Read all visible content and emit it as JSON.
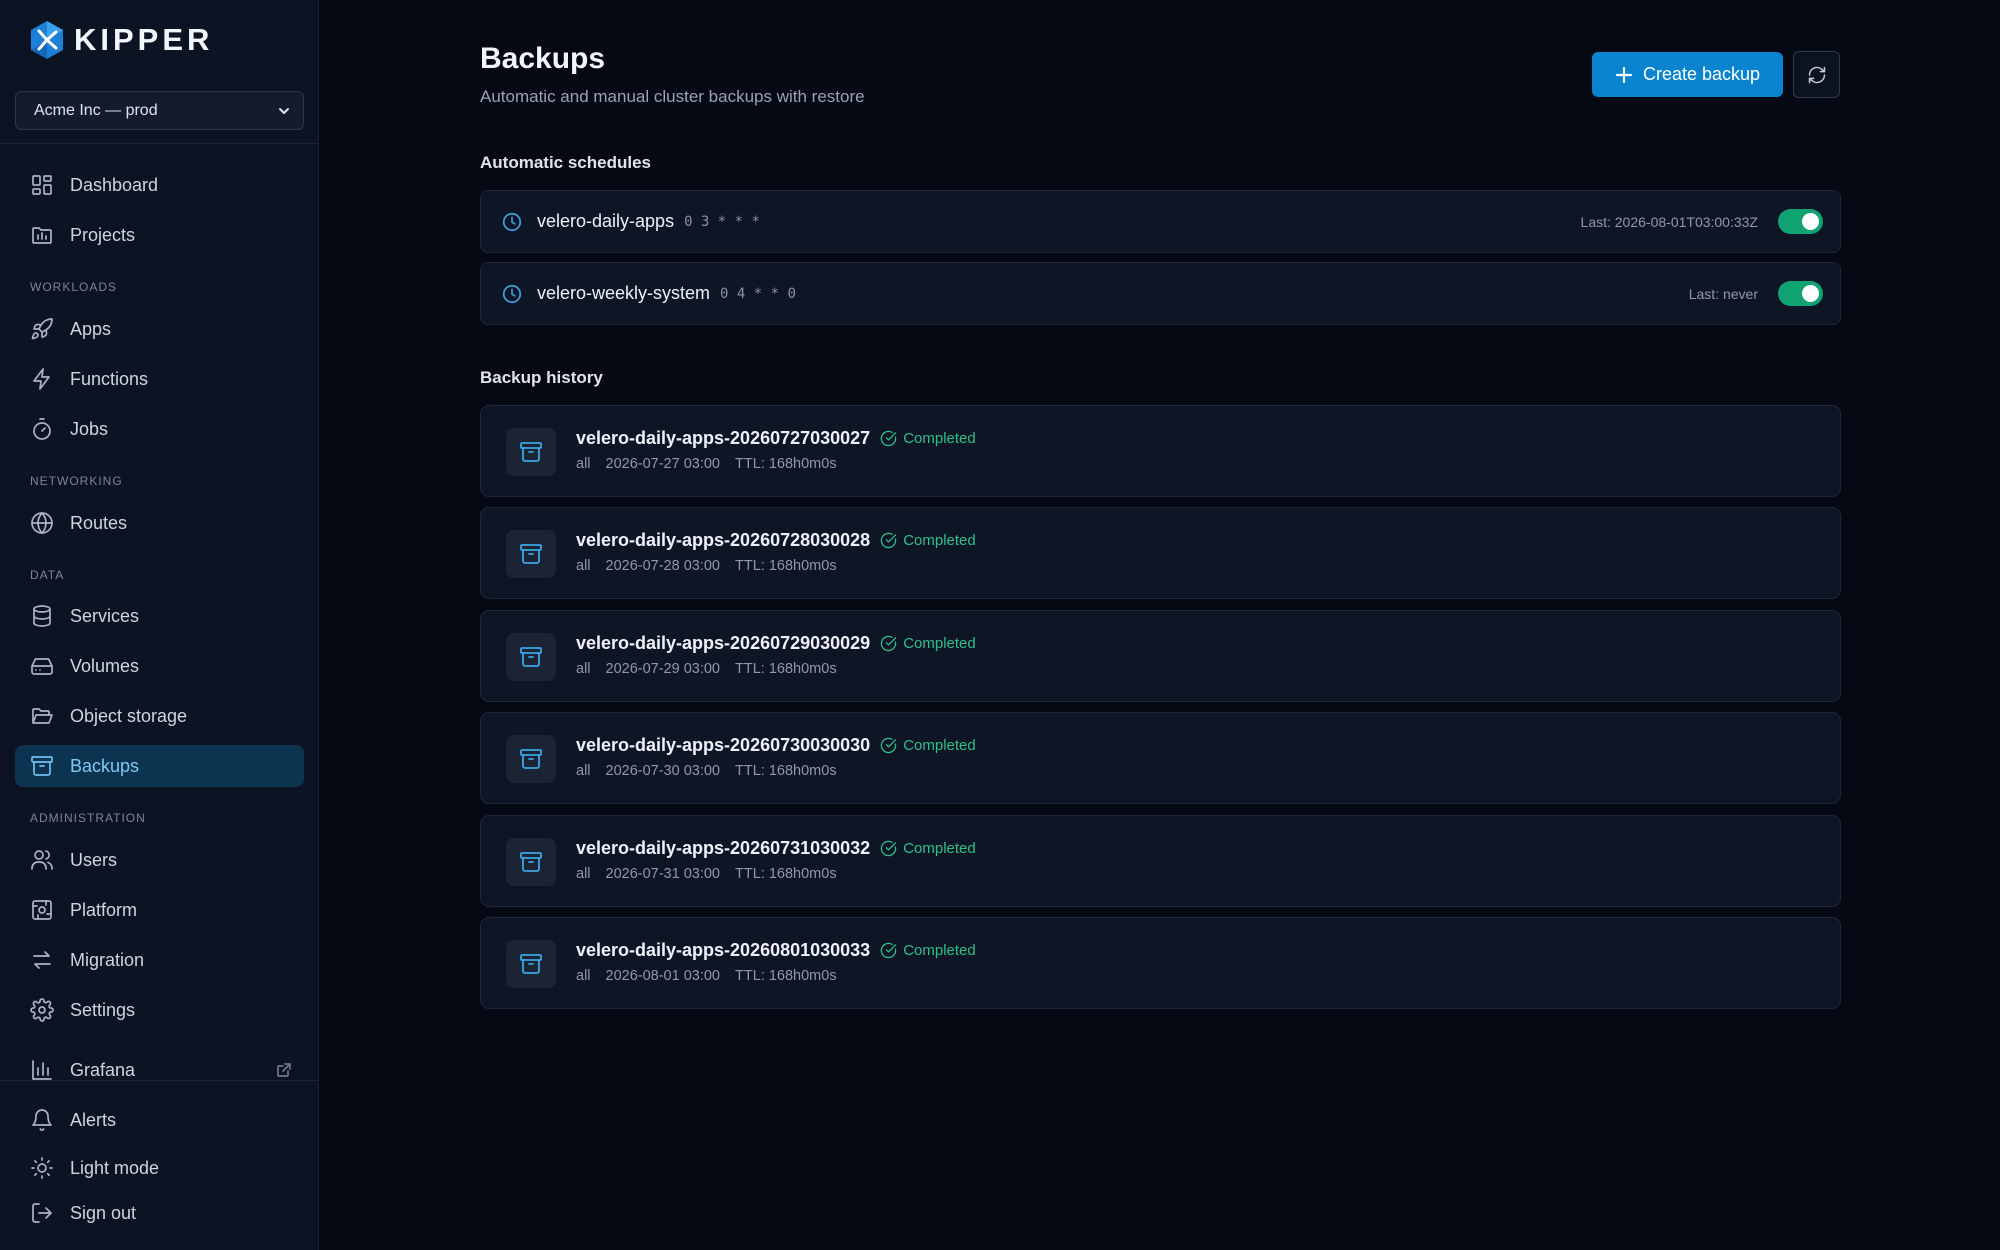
{
  "brand": {
    "name": "KIPPER"
  },
  "org_selector": {
    "value": "Acme Inc — prod"
  },
  "sidebar": {
    "top": [
      {
        "label": "Dashboard",
        "icon": "dashboard-icon"
      },
      {
        "label": "Projects",
        "icon": "folder-icon"
      }
    ],
    "sections": {
      "workloads": "WORKLOADS",
      "networking": "NETWORKING",
      "data": "DATA",
      "administration": "ADMINISTRATION"
    },
    "workloads": [
      {
        "label": "Apps",
        "icon": "rocket-icon"
      },
      {
        "label": "Functions",
        "icon": "bolt-icon"
      },
      {
        "label": "Jobs",
        "icon": "timer-icon"
      }
    ],
    "networking": [
      {
        "label": "Routes",
        "icon": "globe-icon"
      }
    ],
    "data": [
      {
        "label": "Services",
        "icon": "database-icon"
      },
      {
        "label": "Volumes",
        "icon": "hard-drive-icon"
      },
      {
        "label": "Object storage",
        "icon": "folder-open-icon"
      },
      {
        "label": "Backups",
        "icon": "archive-icon",
        "active": true
      }
    ],
    "administration": [
      {
        "label": "Users",
        "icon": "users-icon"
      },
      {
        "label": "Platform",
        "icon": "platform-icon"
      },
      {
        "label": "Migration",
        "icon": "arrows-swap-icon"
      },
      {
        "label": "Settings",
        "icon": "gear-icon"
      }
    ],
    "external": {
      "label": "Grafana",
      "icon": "bar-chart-icon"
    },
    "footer": [
      {
        "label": "Alerts",
        "icon": "bell-icon"
      },
      {
        "label": "Light mode",
        "icon": "sun-icon"
      },
      {
        "label": "Sign out",
        "icon": "sign-out-icon"
      }
    ]
  },
  "header": {
    "title": "Backups",
    "subtitle": "Automatic and manual cluster backups with restore",
    "create_label": "Create backup"
  },
  "schedules": {
    "title": "Automatic schedules",
    "items": [
      {
        "name": "velero-daily-apps",
        "cron": "0 3 * * *",
        "last": "Last: 2026-08-01T03:00:33Z",
        "enabled": true
      },
      {
        "name": "velero-weekly-system",
        "cron": "0 4 * * 0",
        "last": "Last: never",
        "enabled": true
      }
    ]
  },
  "history": {
    "title": "Backup history",
    "items": [
      {
        "name": "velero-daily-apps-20260727030027",
        "status": "Completed",
        "scope": "all",
        "date": "2026-07-27 03:00",
        "ttl": "TTL: 168h0m0s"
      },
      {
        "name": "velero-daily-apps-20260728030028",
        "status": "Completed",
        "scope": "all",
        "date": "2026-07-28 03:00",
        "ttl": "TTL: 168h0m0s"
      },
      {
        "name": "velero-daily-apps-20260729030029",
        "status": "Completed",
        "scope": "all",
        "date": "2026-07-29 03:00",
        "ttl": "TTL: 168h0m0s"
      },
      {
        "name": "velero-daily-apps-20260730030030",
        "status": "Completed",
        "scope": "all",
        "date": "2026-07-30 03:00",
        "ttl": "TTL: 168h0m0s"
      },
      {
        "name": "velero-daily-apps-20260731030032",
        "status": "Completed",
        "scope": "all",
        "date": "2026-07-31 03:00",
        "ttl": "TTL: 168h0m0s"
      },
      {
        "name": "velero-daily-apps-20260801030033",
        "status": "Completed",
        "scope": "all",
        "date": "2026-08-01 03:00",
        "ttl": "TTL: 168h0m0s"
      }
    ]
  },
  "colors": {
    "accent": "#0a84cf",
    "success": "#2fbf8a",
    "toggle_on": "#0fa372",
    "background": "#050914",
    "sidebar": "#0c1423"
  }
}
